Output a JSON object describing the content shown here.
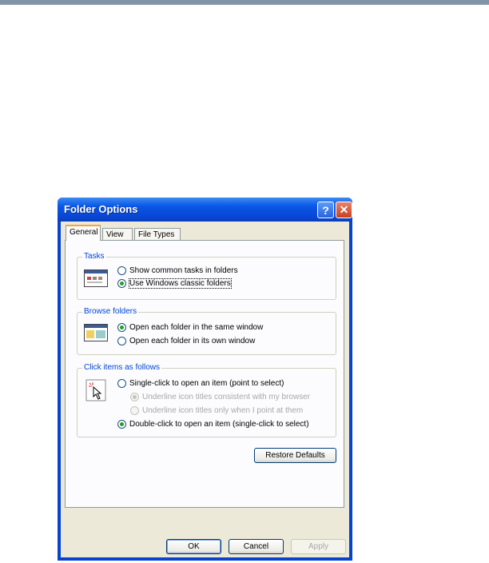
{
  "window": {
    "title": "Folder Options"
  },
  "title_buttons": {
    "help": "?",
    "close": "✕"
  },
  "tabs": [
    {
      "label": "General"
    },
    {
      "label": "View"
    },
    {
      "label": "File Types"
    }
  ],
  "tasks": {
    "label": "Tasks",
    "options": [
      {
        "label": "Show common tasks in folders",
        "checked": false
      },
      {
        "label": "Use Windows classic folders",
        "checked": true
      }
    ]
  },
  "browse": {
    "label": "Browse folders",
    "options": [
      {
        "label": "Open each folder in the same window",
        "checked": true
      },
      {
        "label": "Open each folder in its own window",
        "checked": false
      }
    ]
  },
  "click": {
    "label": "Click items as follows",
    "options": [
      {
        "label": "Single-click to open an item (point to select)",
        "checked": false
      },
      {
        "label": "Underline icon titles consistent with my browser",
        "checked": true,
        "disabled": true
      },
      {
        "label": "Underline icon titles only when I point at them",
        "checked": false,
        "disabled": true
      },
      {
        "label": "Double-click to open an item (single-click to select)",
        "checked": true
      }
    ]
  },
  "buttons": {
    "restore": "Restore Defaults",
    "ok": "OK",
    "cancel": "Cancel",
    "apply": "Apply"
  },
  "icons": {
    "tasks": "folder-window-icon",
    "browse": "folder-window-icon",
    "click": "pointer-click-icon"
  },
  "colors": {
    "titlebar": "#0a58e6",
    "dialog_face": "#ece9d8",
    "group_label": "#0046d5",
    "radio_dot": "#21a121"
  }
}
